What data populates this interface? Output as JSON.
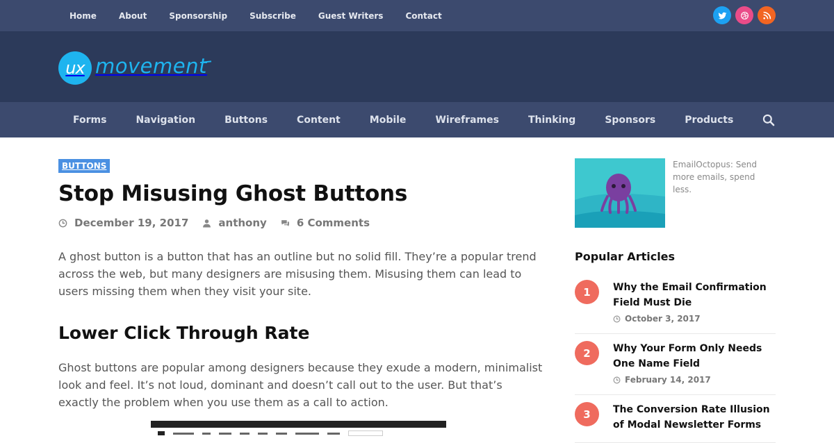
{
  "topbar": {
    "links": [
      "Home",
      "About",
      "Sponsorship",
      "Subscribe",
      "Guest Writers",
      "Contact"
    ],
    "social": [
      {
        "icon": "twitter-icon",
        "color": "#1da1f2"
      },
      {
        "icon": "dribbble-icon",
        "color": "#ea4c89"
      },
      {
        "icon": "rss-icon",
        "color": "#f26522"
      }
    ]
  },
  "header": {
    "logo_badge": "ux",
    "logo_text": "movement"
  },
  "mainnav": {
    "links": [
      "Forms",
      "Navigation",
      "Buttons",
      "Content",
      "Mobile",
      "Wireframes",
      "Thinking",
      "Sponsors",
      "Products"
    ]
  },
  "article": {
    "category": "BUTTONS",
    "title": "Stop Misusing Ghost Buttons",
    "date": "December 19, 2017",
    "author": "anthony",
    "comments": "6 Comments",
    "intro": "A ghost button is a button that has an outline but no solid fill. They’re a popular trend across the web, but many designers are misusing them. Misusing them can lead to users missing them when they visit your site.",
    "heading": "Lower Click Through Rate",
    "body": "Ghost buttons are popular among designers because they exude a modern, minimalist look and feel. It’s not loud, dominant and doesn’t call out to the user. But that’s exactly the problem when you use them as a call to action."
  },
  "sidebar": {
    "ad_text": "EmailOctopus: Send more emails, spend less.",
    "popular_title": "Popular Articles",
    "popular": [
      {
        "num": "1",
        "title": "Why the Email Confirmation Field Must Die",
        "date": "October 3, 2017"
      },
      {
        "num": "2",
        "title": "Why Your Form Only Needs One Name Field",
        "date": "February 14, 2017"
      },
      {
        "num": "3",
        "title": "The Conversion Rate Illusion of Modal Newsletter Forms",
        "date": ""
      }
    ]
  },
  "colors": {
    "topbar": "#3c4a6e",
    "header": "#2c3a5a",
    "accent": "#1eb4ef",
    "category_badge": "#4a90e2",
    "popular_number": "#ef6b5e"
  }
}
